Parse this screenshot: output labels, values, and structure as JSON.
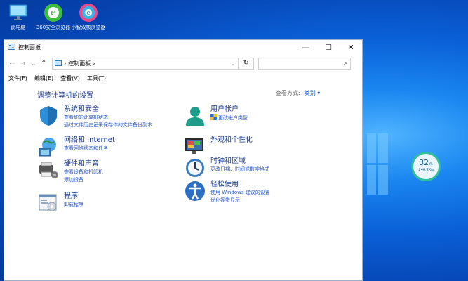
{
  "desktop": {
    "icons": [
      {
        "label": "此电脑",
        "icon": "monitor-icon"
      },
      {
        "label": "360安全浏览器",
        "icon": "browser-360-icon"
      },
      {
        "label": "小智双核浏览器",
        "icon": "browser-xiaozhi-icon"
      }
    ],
    "gauge": {
      "percent": "32",
      "unit": "%",
      "speed": "↓46.2K/s",
      "accent": "#2fbf9a"
    }
  },
  "window": {
    "title": "控制面板",
    "controls": {
      "minimize": "—",
      "maximize": "☐",
      "close": "✕"
    },
    "nav": {
      "back": "←",
      "forward": "→",
      "recent": "⌄",
      "up": "↑",
      "refresh": "↻",
      "search_placeholder": ""
    },
    "address": [
      "›",
      "控制面板",
      "›"
    ],
    "menu": [
      "文件(F)",
      "编辑(E)",
      "查看(V)",
      "工具(T)"
    ],
    "heading": "调整计算机的设置",
    "view_by": {
      "label": "查看方式:",
      "value": "类别 ▾"
    },
    "categories": [
      {
        "title": "系统和安全",
        "links": [
          "查看你的计算机状态",
          "通过文件历史记录保存你的文件备份副本"
        ],
        "icon": "system-security-icon"
      },
      {
        "title": "网络和 Internet",
        "links": [
          "查看网络状态和任务"
        ],
        "icon": "network-icon"
      },
      {
        "title": "硬件和声音",
        "links": [
          "查看设备和打印机",
          "添加设备"
        ],
        "icon": "hardware-sound-icon"
      },
      {
        "title": "程序",
        "links": [
          "卸载程序"
        ],
        "icon": "programs-icon"
      },
      {
        "title": "用户帐户",
        "links": [
          "更改帐户类型"
        ],
        "icon": "user-accounts-icon"
      },
      {
        "title": "外观和个性化",
        "links": [],
        "icon": "appearance-icon"
      },
      {
        "title": "时钟和区域",
        "links": [
          "更改日期、时间或数字格式"
        ],
        "icon": "clock-region-icon"
      },
      {
        "title": "轻松使用",
        "links": [
          "使用 Windows 建议的设置",
          "优化视觉显示"
        ],
        "icon": "ease-of-access-icon"
      }
    ]
  },
  "colors": {
    "link": "#2456c8",
    "heading": "#1a3a8c",
    "desktop": "#0a5fd6"
  }
}
